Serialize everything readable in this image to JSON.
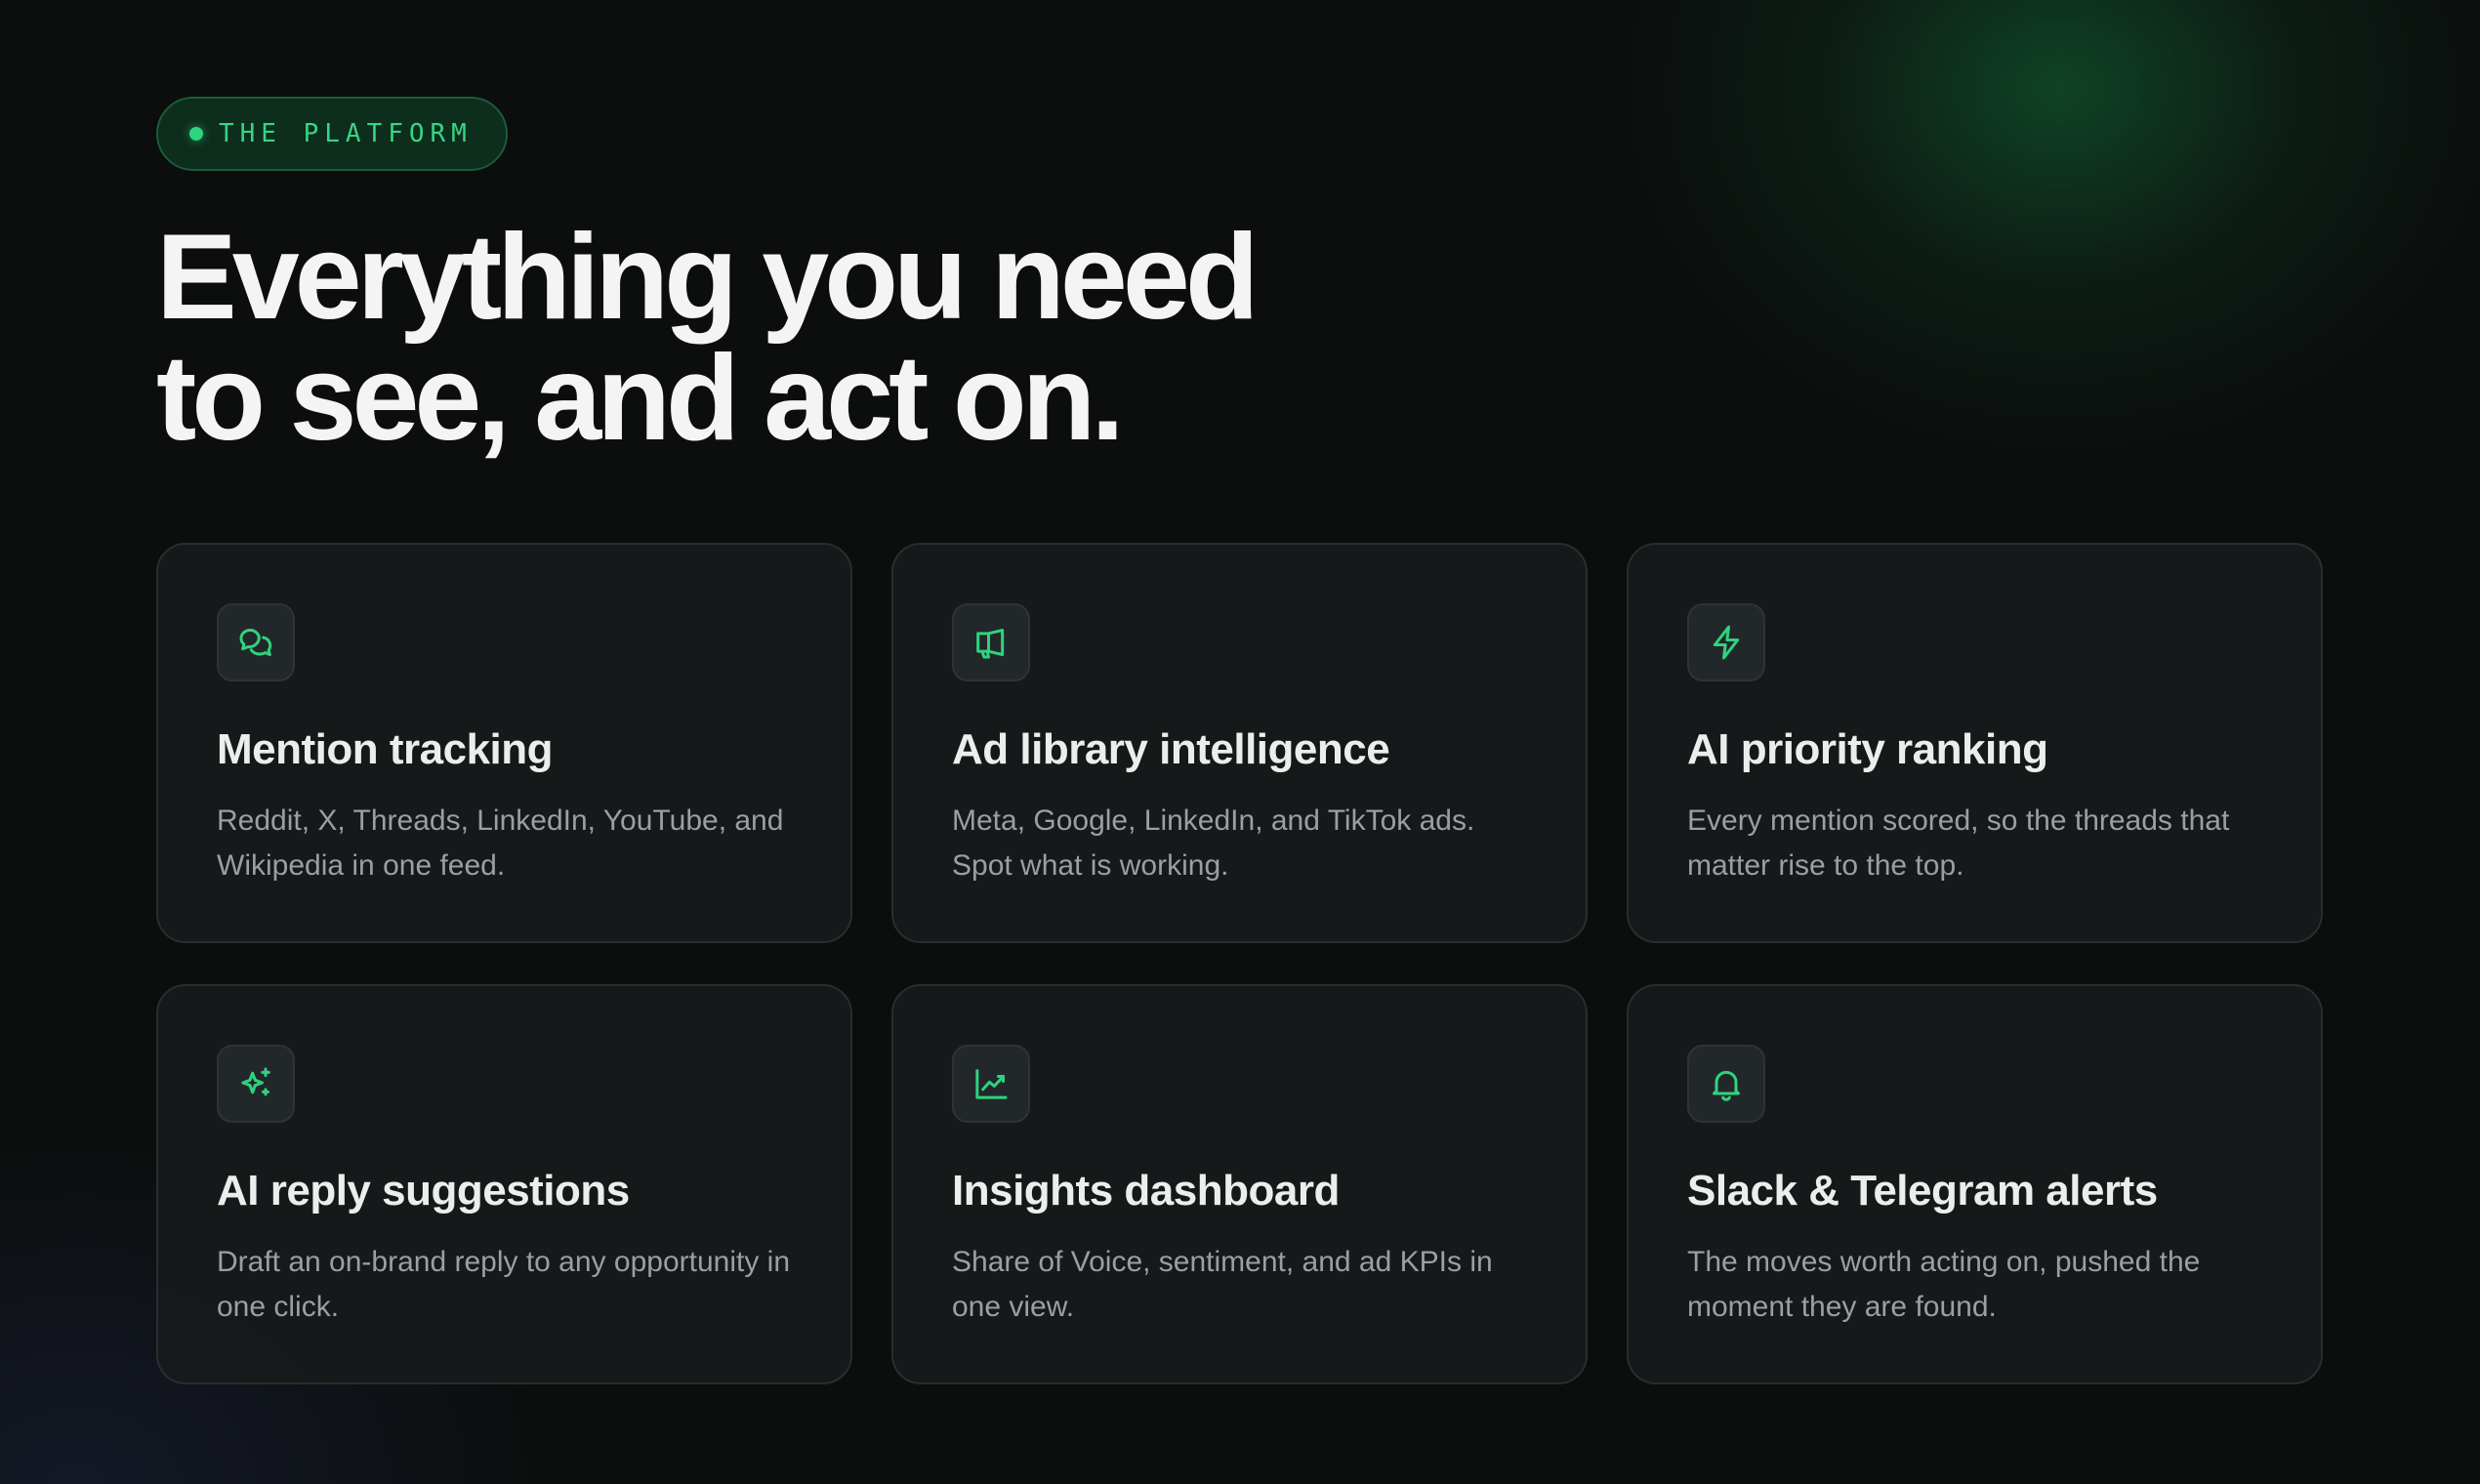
{
  "badge": {
    "label": "THE PLATFORM"
  },
  "headline": {
    "line1": "Everything you need",
    "line2": "to see, and act on."
  },
  "colors": {
    "accent": "#2fd37f",
    "background": "#0c0d0d",
    "card": "#181a1b",
    "title": "#eceeed",
    "body": "#9a9fa3"
  },
  "features": [
    {
      "icon": "chat-bubbles-icon",
      "title": "Mention tracking",
      "description": "Reddit, X, Threads, LinkedIn, YouTube, and Wikipedia in one feed."
    },
    {
      "icon": "megaphone-icon",
      "title": "Ad library intelligence",
      "description": "Meta, Google, LinkedIn, and TikTok ads. Spot what is working."
    },
    {
      "icon": "lightning-bolt-icon",
      "title": "AI priority ranking",
      "description": "Every mention scored, so the threads that matter rise to the top."
    },
    {
      "icon": "sparkles-icon",
      "title": "AI reply suggestions",
      "description": "Draft an on-brand reply to any opportunity in one click."
    },
    {
      "icon": "trend-chart-icon",
      "title": "Insights dashboard",
      "description": "Share of Voice, sentiment, and ad KPIs in one view."
    },
    {
      "icon": "bell-icon",
      "title": "Slack & Telegram alerts",
      "description": "The moves worth acting on, pushed the moment they are found."
    }
  ]
}
